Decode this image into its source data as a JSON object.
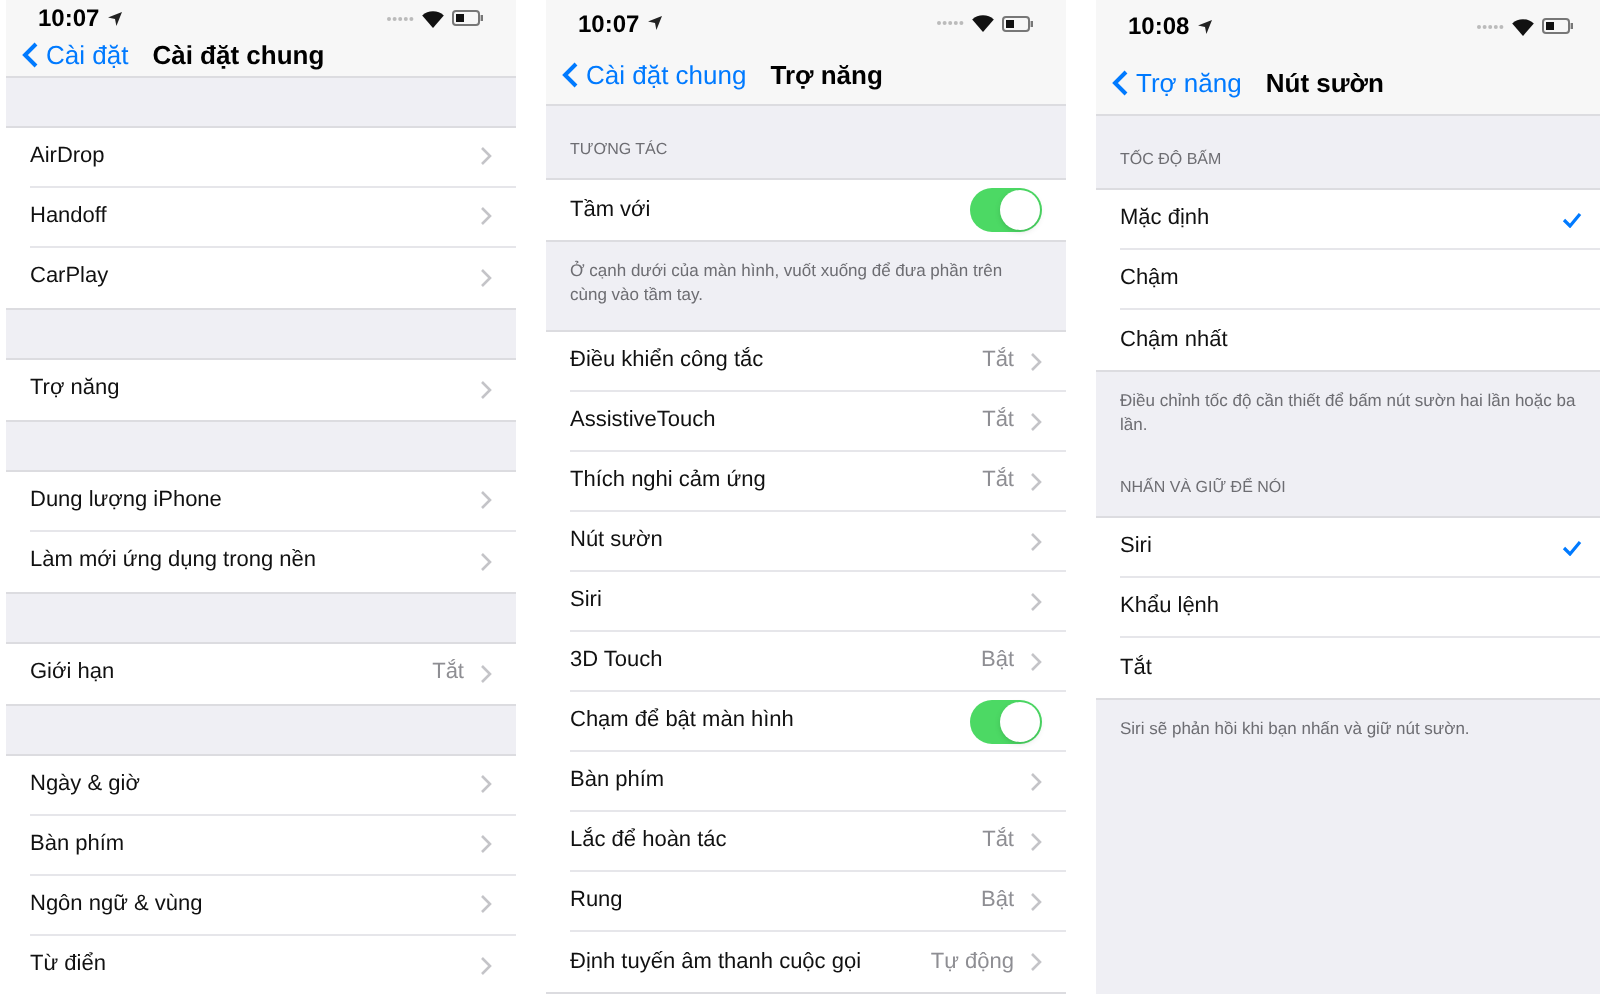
{
  "panels": [
    {
      "status_time": "10:07",
      "nav": {
        "back": "Cài đặt",
        "title": "Cài đặt chung"
      },
      "sections": [
        {
          "rows": [
            {
              "kind": "link",
              "label": "AirDrop"
            },
            {
              "kind": "link",
              "label": "Handoff"
            },
            {
              "kind": "link",
              "label": "CarPlay"
            }
          ]
        },
        {
          "rows": [
            {
              "kind": "link",
              "label": "Trợ năng"
            }
          ]
        },
        {
          "rows": [
            {
              "kind": "link",
              "label": "Dung lượng iPhone"
            },
            {
              "kind": "link",
              "label": "Làm mới ứng dụng trong nền"
            }
          ]
        },
        {
          "rows": [
            {
              "kind": "link",
              "label": "Giới hạn",
              "value": "Tắt"
            }
          ]
        },
        {
          "rows": [
            {
              "kind": "link",
              "label": "Ngày & giờ"
            },
            {
              "kind": "link",
              "label": "Bàn phím"
            },
            {
              "kind": "link",
              "label": "Ngôn ngữ & vùng"
            },
            {
              "kind": "link",
              "label": "Từ điển"
            }
          ]
        }
      ]
    },
    {
      "status_time": "10:07",
      "nav": {
        "back": "Cài đặt chung",
        "title": "Trợ năng"
      },
      "sections": [
        {
          "header": "TƯƠNG TÁC",
          "rows": [
            {
              "kind": "toggle",
              "label": "Tầm với",
              "on": true
            }
          ],
          "footer": "Ở cạnh dưới của màn hình, vuốt xuống để đưa phần trên cùng vào tầm tay."
        },
        {
          "rows": [
            {
              "kind": "link",
              "label": "Điều khiển công tắc",
              "value": "Tắt"
            },
            {
              "kind": "link",
              "label": "AssistiveTouch",
              "value": "Tắt"
            },
            {
              "kind": "link",
              "label": "Thích nghi cảm ứng",
              "value": "Tắt"
            },
            {
              "kind": "link",
              "label": "Nút sườn"
            },
            {
              "kind": "link",
              "label": "Siri"
            },
            {
              "kind": "link",
              "label": "3D Touch",
              "value": "Bật"
            },
            {
              "kind": "toggle",
              "label": "Chạm để bật màn hình",
              "on": true
            },
            {
              "kind": "link",
              "label": "Bàn phím"
            },
            {
              "kind": "link",
              "label": "Lắc để hoàn tác",
              "value": "Tắt"
            },
            {
              "kind": "link",
              "label": "Rung",
              "value": "Bật"
            },
            {
              "kind": "link",
              "label": "Định tuyến âm thanh cuộc gọi",
              "value": "Tự động"
            }
          ]
        }
      ]
    },
    {
      "status_time": "10:08",
      "nav": {
        "back": "Trợ năng",
        "title": "Nút sườn"
      },
      "sections": [
        {
          "header": "TỐC ĐỘ BẤM",
          "rows": [
            {
              "kind": "check",
              "label": "Mặc định",
              "selected": true
            },
            {
              "kind": "check",
              "label": "Chậm",
              "selected": false
            },
            {
              "kind": "check",
              "label": "Chậm nhất",
              "selected": false
            }
          ],
          "footer": "Điều chỉnh tốc độ cần thiết để bấm nút sườn hai lần hoặc ba lần."
        },
        {
          "header": "NHẤN VÀ GIỮ ĐỂ NÓI",
          "rows": [
            {
              "kind": "check",
              "label": "Siri",
              "selected": true
            },
            {
              "kind": "check",
              "label": "Khẩu lệnh",
              "selected": false
            },
            {
              "kind": "check",
              "label": "Tắt",
              "selected": false
            }
          ],
          "footer": "Siri sẽ phản hồi khi bạn nhấn và giữ nút sườn."
        }
      ]
    }
  ]
}
